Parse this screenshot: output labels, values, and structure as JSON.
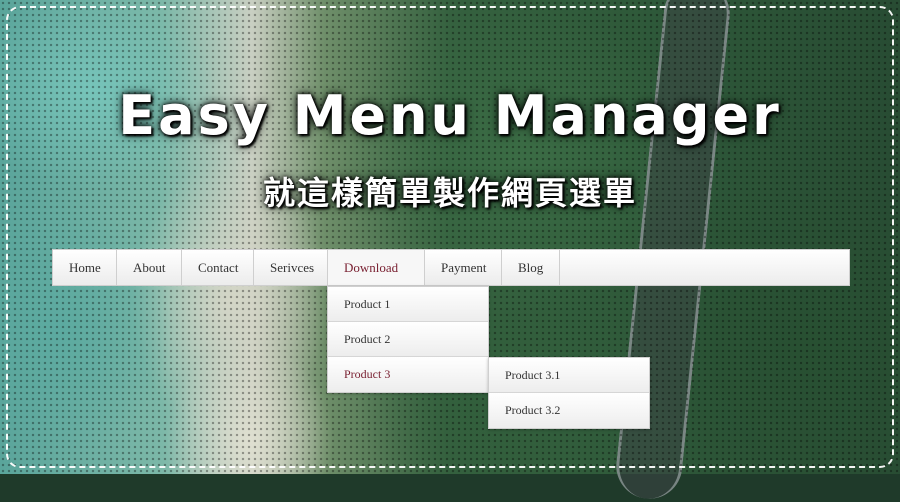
{
  "banner": {
    "title": "Easy Menu Manager",
    "subtitle": "就這樣簡單製作網頁選單"
  },
  "menu": {
    "items": [
      "Home",
      "About",
      "Contact",
      "Serivces",
      "Download",
      "Payment",
      "Blog"
    ],
    "active": "Download",
    "accent_color": "#7a2233"
  },
  "download_submenu": {
    "items": [
      "Product 1",
      "Product 2",
      "Product 3"
    ],
    "active": "Product 3"
  },
  "product3_submenu": {
    "items": [
      "Product 3.1",
      "Product 3.2"
    ]
  }
}
